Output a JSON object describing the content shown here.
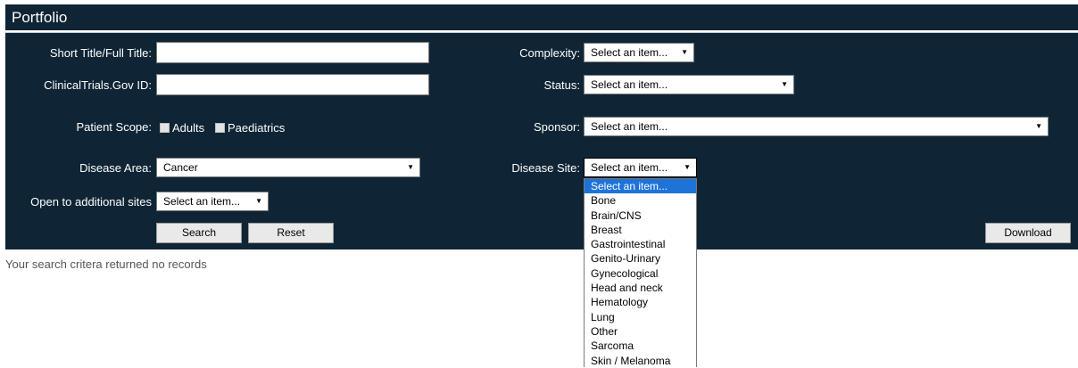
{
  "header": {
    "title": "Portfolio"
  },
  "form": {
    "short_title_label": "Short Title/Full Title:",
    "short_title_value": "",
    "ct_gov_label": "ClinicalTrials.Gov ID:",
    "ct_gov_value": "",
    "patient_scope_label": "Patient Scope:",
    "patient_scope_options": [
      {
        "label": "Adults",
        "checked": false
      },
      {
        "label": "Paediatrics",
        "checked": false
      }
    ],
    "disease_area_label": "Disease Area:",
    "disease_area_value": "Cancer",
    "open_sites_label": "Open to additional sites",
    "open_sites_value": "Select an item...",
    "complexity_label": "Complexity:",
    "complexity_value": "Select an item...",
    "status_label": "Status:",
    "status_value": "Select an item...",
    "sponsor_label": "Sponsor:",
    "sponsor_value": "Select an item...",
    "disease_site_label": "Disease Site:",
    "disease_site_value": "Select an item..."
  },
  "buttons": {
    "search": "Search",
    "reset": "Reset",
    "download": "Download"
  },
  "results": {
    "message": "Your search critera returned no records"
  },
  "disease_site_dropdown": {
    "options": [
      "Select an item...",
      "Bone",
      "Brain/CNS",
      "Breast",
      "Gastrointestinal",
      "Genito-Urinary",
      "Gynecological",
      "Head and neck",
      "Hematology",
      "Lung",
      "Other",
      "Sarcoma",
      "Skin / Melanoma"
    ],
    "highlighted_index": 0
  },
  "colors": {
    "panel_bg": "#0f2535",
    "highlight": "#1e73d9"
  },
  "icons": {
    "select_arrow": "triangle-down-icon"
  }
}
